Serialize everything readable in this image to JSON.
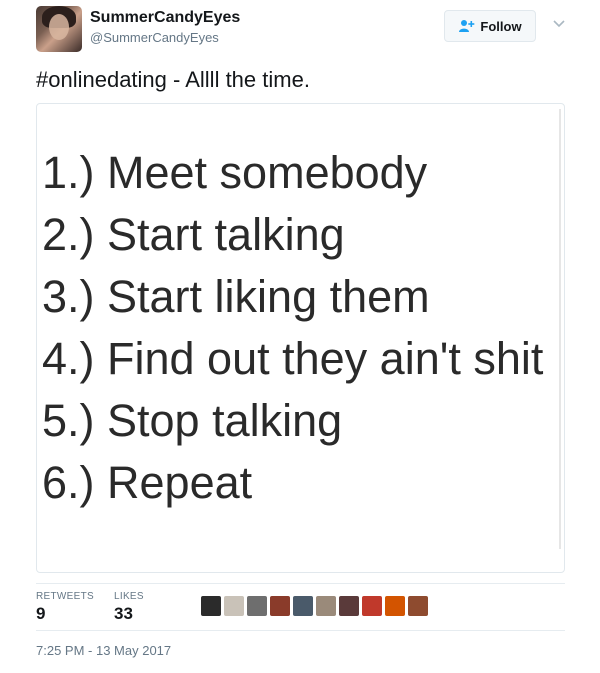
{
  "header": {
    "display_name": "SummerCandyEyes",
    "handle": "@SummerCandyEyes",
    "follow_label": "Follow"
  },
  "tweet": {
    "text": "#onlinedating - Allll the time.",
    "image_lines": [
      "1.) Meet somebody",
      "2.) Start talking",
      "3.) Start liking them",
      "4.) Find out they ain't shit",
      "5.) Stop talking",
      "6.) Repeat"
    ]
  },
  "stats": {
    "retweets_label": "RETWEETS",
    "retweets_count": "9",
    "likes_label": "LIKES",
    "likes_count": "33"
  },
  "likers": [
    {
      "icon": "liker-avatar",
      "color": "#2b2b2b"
    },
    {
      "icon": "liker-avatar",
      "color": "#c9c2b8"
    },
    {
      "icon": "liker-avatar",
      "color": "#6e6e6e"
    },
    {
      "icon": "liker-avatar",
      "color": "#8a3b2a"
    },
    {
      "icon": "liker-avatar",
      "color": "#4a5a6a"
    },
    {
      "icon": "liker-avatar",
      "color": "#9a8a7a"
    },
    {
      "icon": "liker-avatar",
      "color": "#5a3a3a"
    },
    {
      "icon": "liker-avatar",
      "color": "#c0392b"
    },
    {
      "icon": "liker-avatar",
      "color": "#d35400"
    },
    {
      "icon": "liker-avatar",
      "color": "#8e4b2f"
    }
  ],
  "timestamp": "7:25 PM - 13 May 2017",
  "colors": {
    "accent": "#1da1f2",
    "text": "#14171a",
    "muted": "#657786",
    "border": "#e1e8ed"
  }
}
